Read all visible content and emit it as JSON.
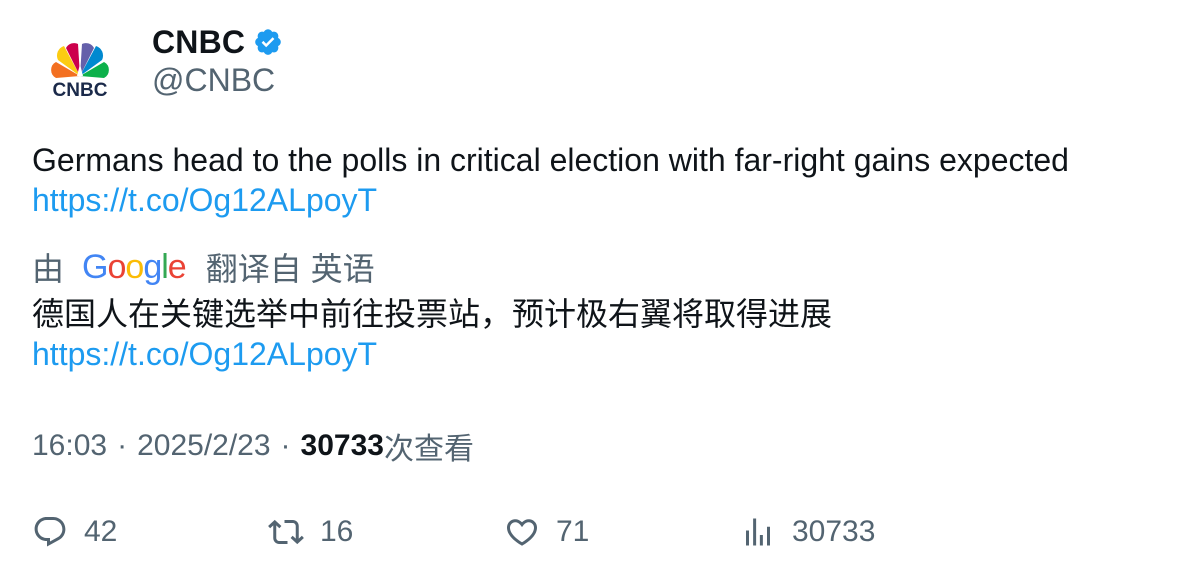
{
  "author": {
    "display_name": "CNBC",
    "handle": "@CNBC",
    "verified_icon": "verified-badge-icon",
    "avatar_logo_text": "CNBC",
    "brand_color": "#1d9bf0"
  },
  "tweet": {
    "text": "Germans head to the polls in critical election with far-right gains expected",
    "link": "https://t.co/Og12ALpoyT"
  },
  "translation": {
    "by_label": "由",
    "provider": "Google",
    "from_label": "翻译自 英语",
    "text": "德国人在关键选举中前往投票站，预计极右翼将取得进展",
    "link": "https://t.co/Og12ALpoyT"
  },
  "meta": {
    "time": "16:03",
    "date": "2025/2/23",
    "separator": "·",
    "views_count": "30733",
    "views_label": "次查看"
  },
  "actions": {
    "replies": "42",
    "retweets": "16",
    "likes": "71",
    "views": "30733"
  }
}
